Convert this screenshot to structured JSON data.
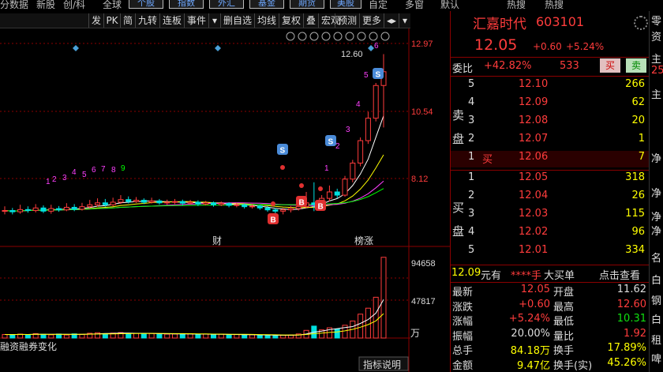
{
  "top_menu": {
    "items": [
      "分",
      "数据",
      "新股",
      "创/科",
      "全球"
    ],
    "buttons": [
      "个股",
      "指数",
      "外汇",
      "基金",
      "期货",
      "美股"
    ],
    "right_items": [
      "自定",
      "多窗",
      "默认",
      "热搜",
      "热搜"
    ]
  },
  "toolbar": {
    "items": [
      "发",
      "PK",
      "简",
      "九转",
      "连板",
      "事件",
      "▾",
      "删自选",
      "均线",
      "复权",
      "叠",
      "宏观",
      "预测",
      "更多",
      "◂▸",
      "▾"
    ]
  },
  "chart_tools": [
    "eye-icon",
    "hand-icon",
    "play-icon",
    "ruler-icon",
    "time-icon",
    "scissor-icon",
    "dot-icon",
    "zoom-in-icon",
    "zoom-out-icon"
  ],
  "chart_labels": {
    "high_marker": "12.60",
    "y_ticks": [
      "12.97",
      "10.54",
      "8.12"
    ],
    "vol_ticks": [
      "94658",
      "47817"
    ],
    "vol_unit": "万",
    "tag_cai": "财",
    "tag_bang": "榜涨",
    "bottom_tab": "融资融券变化",
    "footer_btn": "指标说明",
    "count_labels": [
      "1",
      "2",
      "3",
      "4",
      "5",
      "6",
      "7",
      "8",
      "9"
    ],
    "seq_labels": [
      "1",
      "2",
      "3",
      "4",
      "5",
      "6"
    ],
    "signal_S": "S",
    "signal_B": "B"
  },
  "colors": {
    "up": "#ff3c3c",
    "down": "#00e0e0",
    "ma1": "#ffffff",
    "ma2": "#ffff00",
    "ma3": "#ff40ff",
    "ma4": "#00ff00"
  },
  "chart_data": {
    "type": "candlestick",
    "y_range": [
      6.6,
      13.4
    ],
    "candles": [
      {
        "o": 7.7,
        "c": 7.72,
        "h": 7.85,
        "l": 7.6
      },
      {
        "o": 7.72,
        "c": 7.68,
        "h": 7.8,
        "l": 7.6
      },
      {
        "o": 7.68,
        "c": 7.75,
        "h": 7.9,
        "l": 7.62
      },
      {
        "o": 7.75,
        "c": 7.72,
        "h": 7.85,
        "l": 7.65
      },
      {
        "o": 7.72,
        "c": 7.8,
        "h": 7.92,
        "l": 7.66
      },
      {
        "o": 7.8,
        "c": 7.7,
        "h": 7.88,
        "l": 7.64
      },
      {
        "o": 7.7,
        "c": 7.78,
        "h": 7.9,
        "l": 7.62
      },
      {
        "o": 7.78,
        "c": 7.74,
        "h": 7.86,
        "l": 7.68
      },
      {
        "o": 7.74,
        "c": 7.82,
        "h": 7.95,
        "l": 7.7
      },
      {
        "o": 7.82,
        "c": 7.76,
        "h": 7.92,
        "l": 7.7
      },
      {
        "o": 7.76,
        "c": 7.84,
        "h": 7.96,
        "l": 7.72
      },
      {
        "o": 7.84,
        "c": 7.9,
        "h": 8.05,
        "l": 7.78
      },
      {
        "o": 7.9,
        "c": 7.96,
        "h": 8.1,
        "l": 7.84
      },
      {
        "o": 7.96,
        "c": 7.9,
        "h": 8.08,
        "l": 7.84
      },
      {
        "o": 7.9,
        "c": 7.98,
        "h": 8.12,
        "l": 7.85
      },
      {
        "o": 7.98,
        "c": 8.06,
        "h": 8.2,
        "l": 7.92
      },
      {
        "o": 8.06,
        "c": 8.0,
        "h": 8.16,
        "l": 7.94
      },
      {
        "o": 8.0,
        "c": 8.04,
        "h": 8.14,
        "l": 7.96
      },
      {
        "o": 8.04,
        "c": 7.98,
        "h": 8.1,
        "l": 7.92
      },
      {
        "o": 7.98,
        "c": 8.02,
        "h": 8.12,
        "l": 7.94
      },
      {
        "o": 8.02,
        "c": 7.96,
        "h": 8.08,
        "l": 7.9
      },
      {
        "o": 7.96,
        "c": 7.98,
        "h": 8.06,
        "l": 7.9
      },
      {
        "o": 7.98,
        "c": 8.0,
        "h": 8.08,
        "l": 7.92
      },
      {
        "o": 8.0,
        "c": 7.95,
        "h": 8.06,
        "l": 7.88
      },
      {
        "o": 7.95,
        "c": 7.98,
        "h": 8.05,
        "l": 7.9
      },
      {
        "o": 7.98,
        "c": 7.92,
        "h": 8.04,
        "l": 7.86
      },
      {
        "o": 7.92,
        "c": 7.96,
        "h": 8.02,
        "l": 7.88
      },
      {
        "o": 7.96,
        "c": 7.9,
        "h": 8.0,
        "l": 7.84
      },
      {
        "o": 7.9,
        "c": 7.94,
        "h": 8.0,
        "l": 7.86
      },
      {
        "o": 7.94,
        "c": 7.88,
        "h": 7.98,
        "l": 7.82
      },
      {
        "o": 7.88,
        "c": 7.9,
        "h": 7.96,
        "l": 7.82
      },
      {
        "o": 7.9,
        "c": 7.84,
        "h": 7.94,
        "l": 7.78
      },
      {
        "o": 7.84,
        "c": 7.86,
        "h": 7.92,
        "l": 7.78
      },
      {
        "o": 7.86,
        "c": 7.8,
        "h": 7.9,
        "l": 7.74
      },
      {
        "o": 7.8,
        "c": 7.74,
        "h": 7.86,
        "l": 7.68
      },
      {
        "o": 7.74,
        "c": 7.7,
        "h": 7.8,
        "l": 7.62
      },
      {
        "o": 7.7,
        "c": 7.74,
        "h": 7.8,
        "l": 7.6
      },
      {
        "o": 7.74,
        "c": 7.78,
        "h": 7.86,
        "l": 7.66
      },
      {
        "o": 7.78,
        "c": 7.84,
        "h": 7.94,
        "l": 7.72
      },
      {
        "o": 7.84,
        "c": 7.96,
        "h": 8.3,
        "l": 7.8
      },
      {
        "o": 7.96,
        "c": 7.9,
        "h": 8.6,
        "l": 7.7
      },
      {
        "o": 7.9,
        "c": 8.1,
        "h": 8.2,
        "l": 7.86
      },
      {
        "o": 8.1,
        "c": 8.3,
        "h": 8.5,
        "l": 8.0
      },
      {
        "o": 8.3,
        "c": 8.2,
        "h": 8.4,
        "l": 8.1
      },
      {
        "o": 8.2,
        "c": 8.7,
        "h": 8.8,
        "l": 8.15
      },
      {
        "o": 8.7,
        "c": 9.2,
        "h": 9.3,
        "l": 8.6
      },
      {
        "o": 9.2,
        "c": 9.9,
        "h": 10.0,
        "l": 9.1
      },
      {
        "o": 9.9,
        "c": 10.6,
        "h": 10.8,
        "l": 9.8
      },
      {
        "o": 10.6,
        "c": 11.62,
        "h": 11.7,
        "l": 10.5
      },
      {
        "o": 11.62,
        "c": 12.05,
        "h": 12.6,
        "l": 10.31
      }
    ],
    "volumes": [
      4200,
      3900,
      4600,
      4100,
      5200,
      4300,
      3800,
      4700,
      3600,
      4900,
      4400,
      5600,
      6200,
      5100,
      5800,
      6400,
      5000,
      5500,
      4900,
      5300,
      4700,
      4600,
      4800,
      4500,
      5100,
      4200,
      4600,
      4000,
      4500,
      3800,
      4100,
      3500,
      3900,
      3400,
      3000,
      2800,
      3300,
      3600,
      4800,
      9000,
      14000,
      9500,
      12000,
      10500,
      15000,
      20000,
      28000,
      35000,
      47817,
      94658
    ],
    "vol_range": [
      0,
      100000
    ]
  },
  "quote": {
    "name": "汇嘉时代",
    "code": "603101",
    "price": "12.05",
    "change": "+0.60",
    "pct": "+5.24%",
    "weibi_label": "委比",
    "weibi": "+42.82%",
    "weicha": "533",
    "buy_btn": "买",
    "sell_btn": "卖",
    "sell_side_label": "卖盘",
    "buy_side_label": "买盘",
    "sell_levels": [
      {
        "n": "5",
        "p": "12.10",
        "v": "266"
      },
      {
        "n": "4",
        "p": "12.09",
        "v": "62"
      },
      {
        "n": "3",
        "p": "12.08",
        "v": "20"
      },
      {
        "n": "2",
        "p": "12.07",
        "v": "1"
      },
      {
        "n": "1",
        "p": "12.06",
        "v": "7",
        "tag": "买"
      }
    ],
    "buy_levels": [
      {
        "n": "1",
        "p": "12.05",
        "v": "318"
      },
      {
        "n": "2",
        "p": "12.04",
        "v": "26"
      },
      {
        "n": "3",
        "p": "12.03",
        "v": "115"
      },
      {
        "n": "4",
        "p": "12.02",
        "v": "96"
      },
      {
        "n": "5",
        "p": "12.01",
        "v": "334"
      }
    ],
    "bigbuy": {
      "price": "12.09",
      "unit": "元有",
      "stars": "****手",
      "label": "大买单",
      "action": "点击查看"
    },
    "stats": [
      {
        "l1": "最新",
        "v1": "12.05",
        "c1": "red",
        "l2": "开盘",
        "v2": "11.62",
        "c2": "wht"
      },
      {
        "l1": "涨跌",
        "v1": "+0.60",
        "c1": "red",
        "l2": "最高",
        "v2": "12.60",
        "c2": "red"
      },
      {
        "l1": "涨幅",
        "v1": "+5.24%",
        "c1": "red",
        "l2": "最低",
        "v2": "10.31",
        "c2": "grn"
      },
      {
        "l1": "振幅",
        "v1": "20.00%",
        "c1": "wht",
        "l2": "量比",
        "v2": "1.92",
        "c2": "red"
      },
      {
        "l1": "总手",
        "v1": "84.18万",
        "c1": "yel",
        "l2": "换手",
        "v2": "17.89%",
        "c2": "yel"
      },
      {
        "l1": "金额",
        "v1": "9.47亿",
        "c1": "yel",
        "l2": "换手(实)",
        "v2": "45.26%",
        "c2": "yel"
      }
    ]
  },
  "far_right": [
    "零",
    "资",
    "主",
    "25",
    "主",
    "净",
    "净",
    "净",
    "净",
    "名",
    "白",
    "钢",
    "白",
    "租",
    "啤"
  ]
}
